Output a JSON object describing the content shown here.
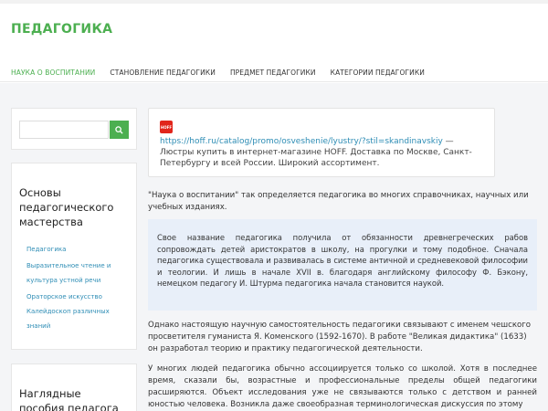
{
  "site": {
    "title": "ПЕДАГОГИКА"
  },
  "nav": {
    "items": [
      {
        "label": "НАУКА О ВОСПИТАНИИ",
        "active": true
      },
      {
        "label": "СТАНОВЛЕНИЕ ПЕДАГОГИКИ",
        "active": false
      },
      {
        "label": "ПРЕДМЕТ ПЕДАГОГИКИ",
        "active": false
      },
      {
        "label": "КАТЕГОРИИ ПЕДАГОГИКИ",
        "active": false
      }
    ]
  },
  "search": {
    "placeholder": "",
    "button_icon": "search-icon"
  },
  "sidebar": {
    "widget1": {
      "title": "Основы педагогического мастерства",
      "links": [
        "Педагогика",
        "Выразительное чтение и культура устной речи",
        "Ораторское искусство",
        "Калейдоскоп различных знаний"
      ]
    },
    "widget2": {
      "title": "Наглядные пособия педагога"
    }
  },
  "ad": {
    "logo_text": "HOFF",
    "url": "https://hoff.ru/catalog/promo/osveshenie/lyustry/?stil=skandinavskiy",
    "dash": " —",
    "text": "Люстры купить в интернет-магазине HOFF. Доставка по Москве, Санкт-Петербургу и всей России. Широкий ассортимент."
  },
  "article": {
    "intro": "\"Наука о воспитании\" так определяется педагогика во многих справочниках, научных или учебных изданиях.",
    "quote": "Свое название педагогика получила от обязанности древнегреческих рабов сопровождать детей аристократов в школу, на прогулки и тому подобное. Сначала педагогика существовала и развивалась в системе античной и средневековой философии и теологии. И лишь в начале XVII в. благодаря английскому философу Ф. Бэкону, немецком педагогу И. Штурма педагогика начала становится наукой.",
    "para2": "Однако настоящую научную самостоятельность педагогики связывают с именем чешского просветителя гуманиста Я. Коменского (1592-1670). В работе \"Великая дидактика\" (1633) он разработал теорию и практику педагогической деятельности.",
    "para3": "У многих людей педагогика обычно ассоциируется только со школой. Хотя в последнее время, сказали бы, возрастные и профессиональные пределы общей педагогики расширяются. Объект исследования уже не связываются только с детством и ранней юностью человека. Возникла даже своеобразная терминологическая дискуссия по этому"
  },
  "colors": {
    "accent": "#4caf50",
    "link": "#2e8db5",
    "quote_bg": "#e8eff9"
  }
}
